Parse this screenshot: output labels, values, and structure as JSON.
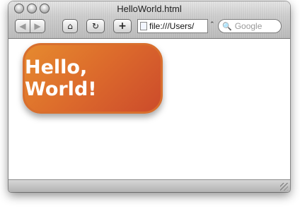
{
  "window": {
    "title": "HelloWorld.html"
  },
  "toolbar": {
    "back_icon": "◀",
    "forward_icon": "▶",
    "home_icon": "⌂",
    "reload_icon": "↻",
    "add_icon": "+",
    "url_value": "file:///Users/",
    "url_menu_icon": "⌃",
    "search_icon": "🔍",
    "search_placeholder": "Google"
  },
  "content": {
    "heading": "Hello, World!"
  }
}
